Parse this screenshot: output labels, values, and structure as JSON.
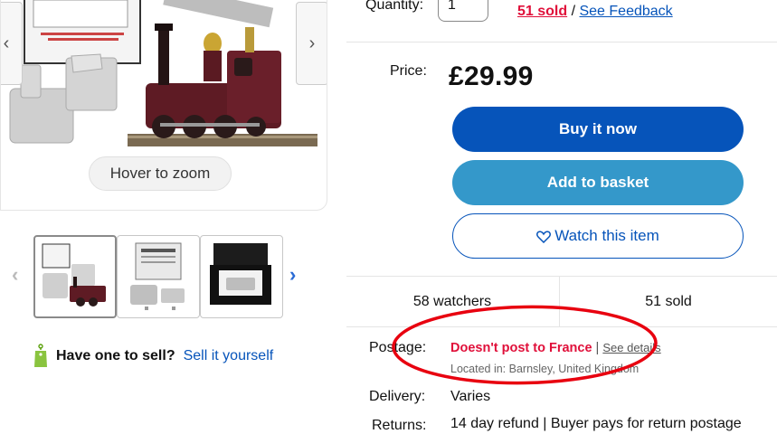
{
  "gallery": {
    "zoom_hint": "Hover to zoom",
    "prev_arrow": "‹",
    "next_arrow": "›"
  },
  "thumbnails": {
    "prev": "‹",
    "next": "›"
  },
  "sell": {
    "label": "Have one to sell?",
    "link": "Sell it yourself"
  },
  "quantity": {
    "label": "Quantity:",
    "value": "1",
    "sold_link": "51 sold",
    "separator": " / ",
    "feedback_link": "See Feedback"
  },
  "price": {
    "label": "Price:",
    "value": "£29.99"
  },
  "buttons": {
    "buy_now": "Buy it now",
    "add_to_basket": "Add to basket",
    "watch": "Watch this item"
  },
  "stats": {
    "watchers": "58 watchers",
    "sold": "51 sold"
  },
  "postage": {
    "label": "Postage:",
    "status": "Doesn't post to France",
    "separator": " | ",
    "details_link": "See details",
    "location": "Located in: Barnsley, United Kingdom"
  },
  "delivery": {
    "label": "Delivery:",
    "value": "Varies"
  },
  "returns": {
    "label": "Returns:",
    "value": "14 day refund | Buyer pays for return postage"
  },
  "colors": {
    "primary_blue": "#0654ba",
    "secondary_blue": "#3498ca",
    "alert_red": "#e0103a",
    "annotation_red": "#e8000f"
  }
}
